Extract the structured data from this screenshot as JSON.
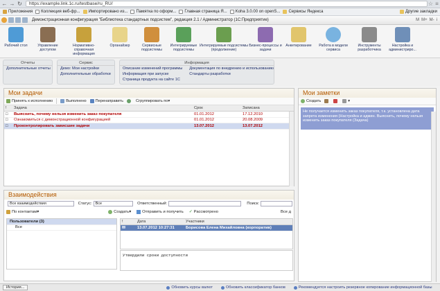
{
  "browser": {
    "url": "https://example.link.1c.ru/testbase/ru_RU/",
    "bookmarks": [
      "Приложения",
      "Коллекция веб-фр...",
      "Импортировано из...",
      "Памятка по оформ...",
      "Главная страница Я...",
      "Koha 3.0.00 on openS...",
      "Сервисы Яндекса"
    ],
    "other_bookmarks": "Другие закладки"
  },
  "app": {
    "title": "Демонстрационная конфигурация \"Библиотека стандартных подсистем\", редакция 2.1 / Администратор (1С:Предприятие)",
    "window_controls": [
      "М",
      "М+",
      "М-",
      "i"
    ]
  },
  "sections": [
    "Рабочий стол",
    "Управление доступом",
    "Нормативно-справочная информация",
    "Органайзер",
    "Сервисные подсистемы",
    "Интегрируемые подсистемы",
    "Интегрируемые подсистемы (продолжение)",
    "Бизнес-процессы и задачи",
    "Анкетирование",
    "Работа в модели сервиса",
    "Инструменты разработчика",
    "Настройка и администриро..."
  ],
  "subsections": {
    "reports": {
      "title": "Отчеты",
      "items": [
        "Дополнительные отчеты"
      ]
    },
    "service": {
      "title": "Сервис",
      "items": [
        "Демо: Мои настройки",
        "Дополнительные обработки"
      ]
    },
    "info": {
      "title": "Информация",
      "col1": [
        "Описание изменений программы",
        "Информация при запуске",
        "Страница продукта на сайте 1С"
      ],
      "col2": [
        "Документация по внедрению и использованию",
        "Стандарты разработки"
      ]
    }
  },
  "tasks": {
    "title": "Мои задачи",
    "toolbar": [
      "Принять к исполнению",
      "Выполнено",
      "Перенаправить",
      "Сгруппировать по"
    ],
    "columns": [
      "Задача",
      "Срок",
      "Записана"
    ],
    "rows": [
      {
        "task": "Выяснить, почему нельзя изменить заказ покупателя",
        "due": "01.01.2012",
        "created": "17.12.2010",
        "style": "boldred"
      },
      {
        "task": "Ознакомиться с демонстрационной конфигурацией",
        "due": "01.01.2012",
        "created": "20.08.2009",
        "style": "red"
      },
      {
        "task": "Проконтролировать зависшие задачи",
        "due": "13.07.2012",
        "created": "13.07.2012",
        "style": "boldred sel"
      }
    ]
  },
  "notes": {
    "title": "Мои заметки",
    "toolbar": [
      "Создать"
    ],
    "items": [
      "Не получается изменить заказ покупателя, т.к. установлена дата запрета изменения (Настройка и админ. Выяснить, почему нельзя изменить заказ покупателя (Задача)"
    ]
  },
  "interactions": {
    "title": "Взаимодействия",
    "filter_value": "Все взаимодействия",
    "status_label": "Статус:",
    "status_value": "Все",
    "responsible_label": "Ответственный:",
    "search_label": "Поиск:",
    "by_contacts": "По контактам",
    "toolbar": [
      "Создать",
      "Отправить и получить",
      "Рассмотрено",
      "Все д"
    ],
    "tree": [
      "Пользователи (3)",
      "Все"
    ],
    "columns": [
      "Дата",
      "Участники"
    ],
    "rows": [
      {
        "date": "13.07.2012 10:27:31",
        "participants": "Борисова Елена Михайловна (корпоратив)"
      }
    ],
    "message": "Утвердили сроки доступности"
  },
  "statusbar": {
    "history": "История...",
    "links": [
      "Обновить курсы валют",
      "Обновить классификатор банков",
      "Рекомендуется настроить резервное копирование информационной базы"
    ]
  }
}
